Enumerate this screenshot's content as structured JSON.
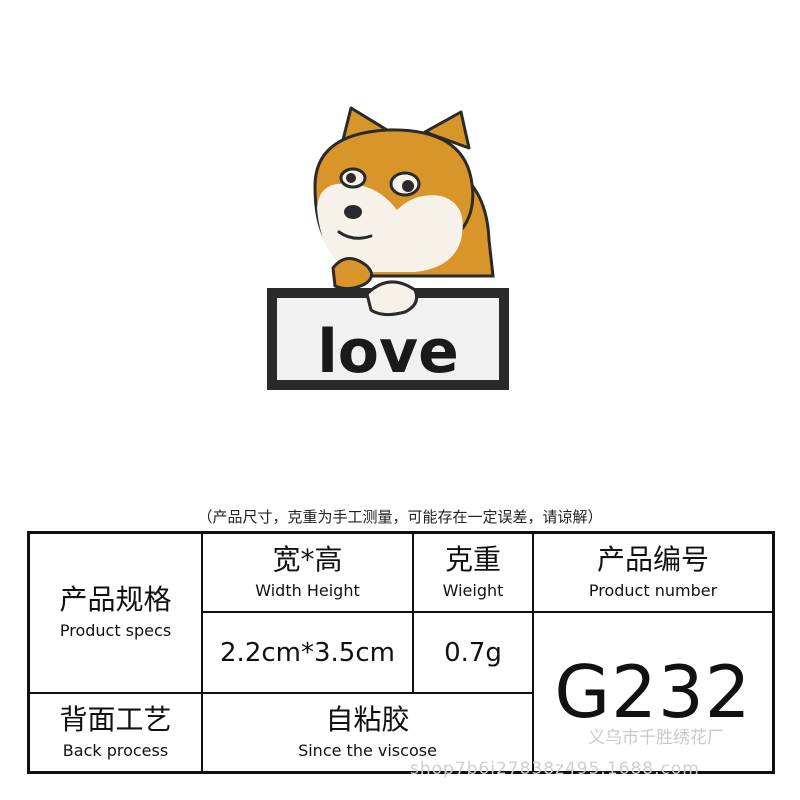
{
  "patch": {
    "text": "love",
    "colors": {
      "fur": "#d8952a",
      "belly": "#f6f2ea",
      "outline": "#2a2a2a",
      "sign": "#f1f1f1"
    }
  },
  "note": "（产品尺寸，克重为手工测量，可能存在一定误差，请谅解）",
  "table": {
    "spec": {
      "zh": "产品规格",
      "en": "Product specs"
    },
    "size": {
      "zh": "宽*高",
      "en": "Width Height",
      "value": "2.2cm*3.5cm"
    },
    "weight": {
      "zh": "克重",
      "en": "Wieight",
      "value": "0.7g"
    },
    "number": {
      "zh": "产品编号",
      "en": "Product number",
      "value": "G232"
    },
    "process": {
      "zh": "背面工艺",
      "en": "Back process"
    },
    "process_value": {
      "zh": "自粘胶",
      "en": "Since the viscose"
    }
  },
  "watermark": {
    "line1": "义乌市千胜绣花厂",
    "line2": "shop7b6i27838z495.1688.com"
  }
}
